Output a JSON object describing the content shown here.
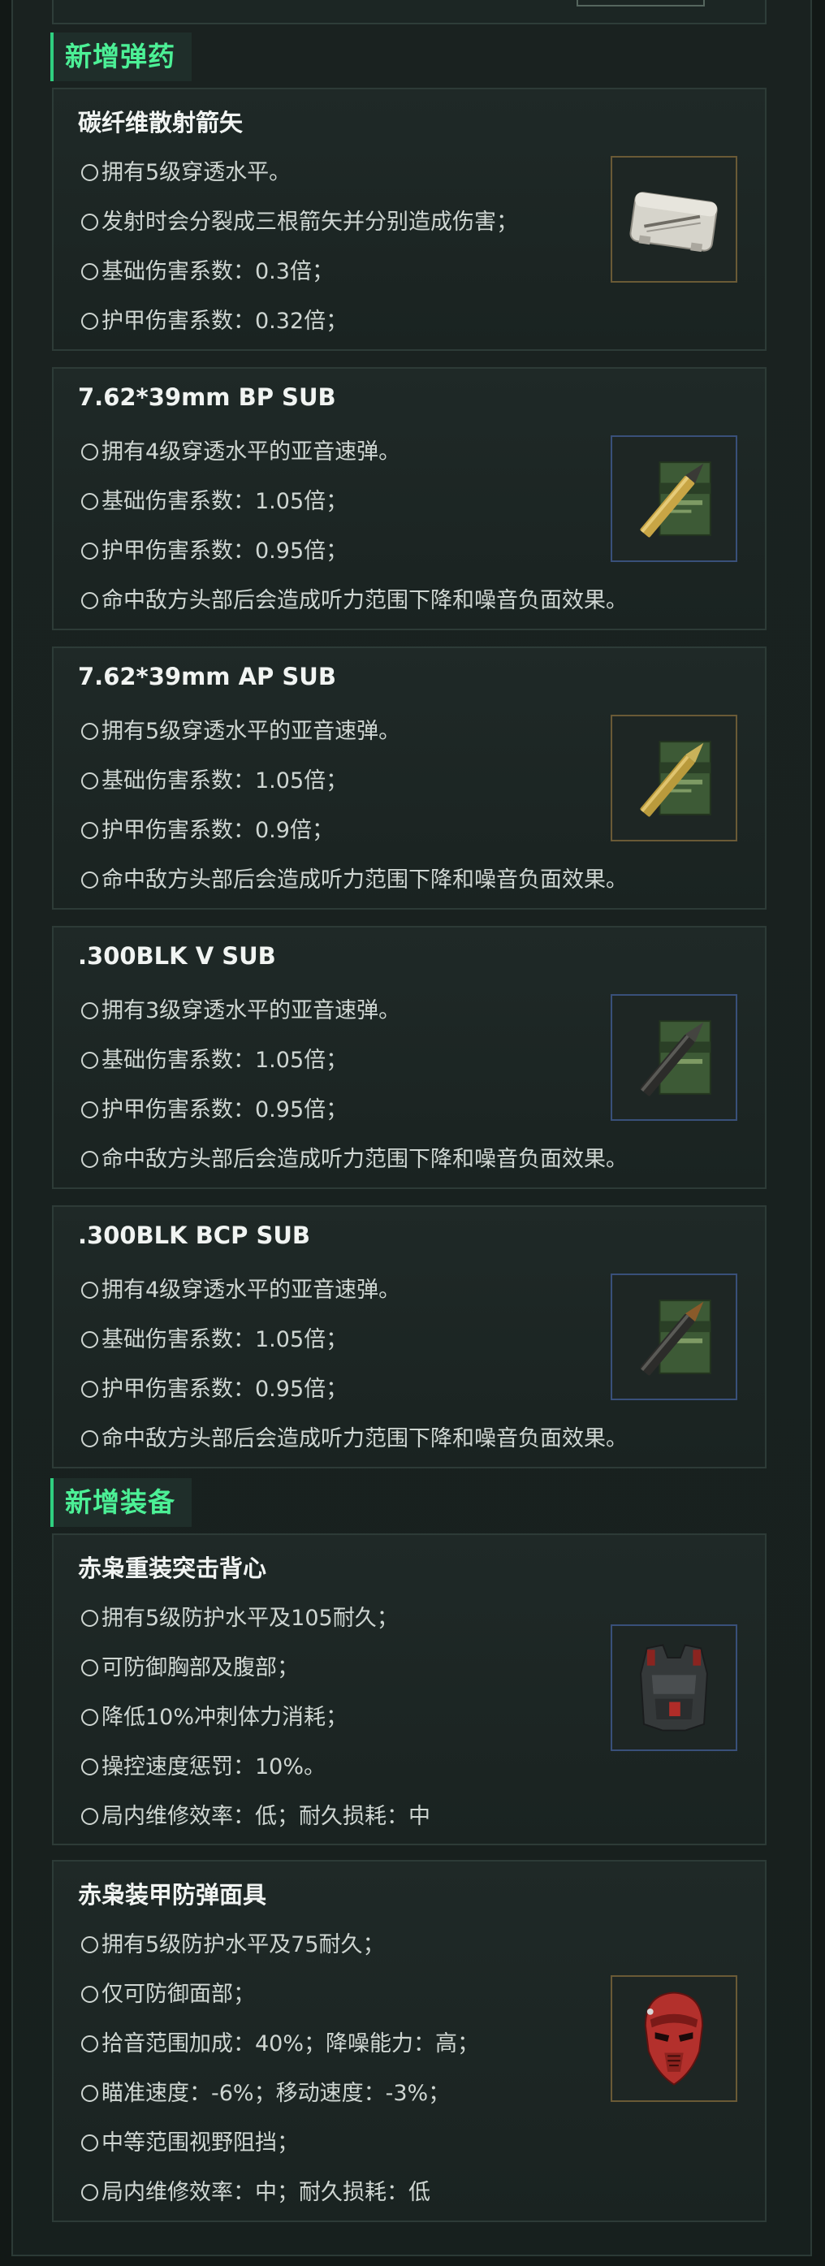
{
  "sections": {
    "ammo_title": "新增弹药",
    "gear_title": "新增装备"
  },
  "ammo": [
    {
      "title": "碳纤维散射箭矢",
      "icon": "arrow-case-icon",
      "lines": [
        "拥有5级穿透水平。",
        "发射时会分裂成三根箭矢并分别造成伤害；",
        "基础伤害系数：0.3倍；",
        "护甲伤害系数：0.32倍；"
      ]
    },
    {
      "title": "7.62*39mm BP SUB",
      "icon": "ammo-box-icon",
      "lines": [
        "拥有4级穿透水平的亚音速弹。",
        "基础伤害系数：1.05倍；",
        "护甲伤害系数：0.95倍；",
        "命中敌方头部后会造成听力范围下降和噪音负面效果。"
      ]
    },
    {
      "title": "7.62*39mm AP SUB",
      "icon": "ammo-box-icon",
      "lines": [
        "拥有5级穿透水平的亚音速弹。",
        "基础伤害系数：1.05倍；",
        "护甲伤害系数：0.9倍；",
        "命中敌方头部后会造成听力范围下降和噪音负面效果。"
      ]
    },
    {
      "title": ".300BLK V SUB",
      "icon": "ammo-box-icon",
      "lines": [
        "拥有3级穿透水平的亚音速弹。",
        "基础伤害系数：1.05倍；",
        "护甲伤害系数：0.95倍；",
        "命中敌方头部后会造成听力范围下降和噪音负面效果。"
      ]
    },
    {
      "title": ".300BLK BCP SUB",
      "icon": "ammo-box-icon",
      "lines": [
        "拥有4级穿透水平的亚音速弹。",
        "基础伤害系数：1.05倍；",
        "护甲伤害系数：0.95倍；",
        "命中敌方头部后会造成听力范围下降和噪音负面效果。"
      ]
    }
  ],
  "gear": [
    {
      "title": "赤枭重装突击背心",
      "icon": "vest-icon",
      "lines": [
        "拥有5级防护水平及105耐久；",
        "可防御胸部及腹部；",
        "降低10%冲刺体力消耗；",
        "操控速度惩罚：10%。",
        "局内维修效率：低；耐久损耗：中"
      ]
    },
    {
      "title": "赤枭装甲防弹面具",
      "icon": "helmet-mask-icon",
      "lines": [
        "拥有5级防护水平及75耐久；",
        "仅可防御面部；",
        "拾音范围加成：40%；降噪能力：高；",
        "瞄准速度：-6%；移动速度：-3%；",
        "中等范围视野阻挡；",
        "局内维修效率：中；耐久损耗：低"
      ]
    }
  ]
}
